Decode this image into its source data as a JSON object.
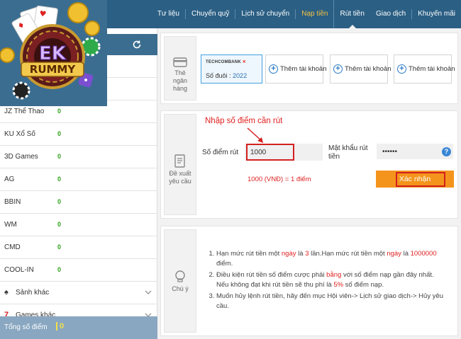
{
  "nav": {
    "items": [
      {
        "label": "Tư liệu",
        "state": "normal"
      },
      {
        "label": "Chuyển quỹ",
        "state": "normal"
      },
      {
        "label": "Lịch sử chuyển",
        "state": "normal"
      },
      {
        "label": "Nạp tiền",
        "state": "highlight"
      },
      {
        "label": "Rút tiền",
        "state": "active"
      },
      {
        "label": "Giao dịch",
        "state": "normal"
      },
      {
        "label": "Khuyến mãi",
        "state": "normal"
      }
    ]
  },
  "logo": {
    "text": "RUMMY",
    "mark": "EK"
  },
  "sidebar": {
    "refresh_icon": "refresh-icon",
    "rows": [
      {
        "label": "",
        "value": ""
      },
      {
        "label": "",
        "value": ""
      },
      {
        "label": "JZ Thể Thao",
        "value": "0"
      },
      {
        "label": "KU Xổ Số",
        "value": "0"
      },
      {
        "label": "3D Games",
        "value": "0"
      },
      {
        "label": "AG",
        "value": "0"
      },
      {
        "label": "BBIN",
        "value": "0"
      },
      {
        "label": "WM",
        "value": "0"
      },
      {
        "label": "CMD",
        "value": "0"
      },
      {
        "label": "COOL-IN",
        "value": "0"
      }
    ],
    "groups": [
      {
        "label": "Sảnh khác",
        "icon": "spade-icon"
      },
      {
        "label": "Games khác",
        "icon": "seven-icon"
      }
    ],
    "total": {
      "label": "Tổng số điểm",
      "value": "0"
    }
  },
  "bank_panel": {
    "side_label": "Thẻ ngân hàng",
    "bank": {
      "logo": "TECHCOMBANK",
      "number_label": "Số đuôi :",
      "number": "2022"
    },
    "add_buttons": [
      "Thêm tài khoản",
      "Thêm tài khoản",
      "Thêm tài khoản"
    ]
  },
  "withdraw_panel": {
    "side_label": "Đề xuất yêu cầu",
    "annotation": "Nhập số điểm cần rút",
    "points_label": "Số điểm rút",
    "points_value": "1000",
    "password_label": "Mật khẩu rút tiền",
    "password_value": "••••••",
    "rate_text": "1000 (VNĐ) = 1 điểm",
    "confirm_label": "Xác nhận"
  },
  "notes_panel": {
    "side_label": "Chú ý",
    "notes": [
      {
        "parts": [
          "Hạn mức rút tiền một ",
          "ngày",
          " là ",
          "3",
          " lần.Hạn mức rút tiền một ",
          "ngày",
          " là ",
          "1000000",
          " điểm."
        ]
      },
      {
        "parts": [
          "Điều kiện rút tiền số điểm cược phải ",
          "bằng",
          " với số điểm nạp gần đây nhất. Nếu không đạt khi rút tiền sẽ thu phí là ",
          "5%",
          " số điểm nạp."
        ]
      },
      {
        "parts": [
          "Muốn hủy lệnh rút tiền, hãy đến mục Hội viên-> Lịch sử giao dịch-> Hủy yêu cầu."
        ]
      }
    ]
  },
  "colors": {
    "nav_bg": "#2b5f84",
    "accent_orange": "#f4941c",
    "alert_red": "#e02020",
    "value_green": "#2fa01d"
  }
}
